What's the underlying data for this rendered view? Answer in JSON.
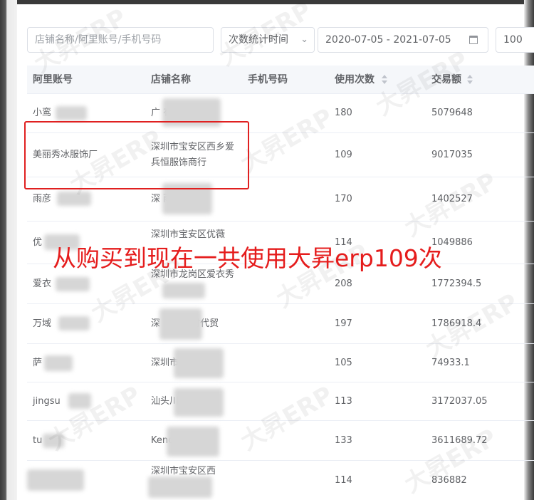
{
  "filters": {
    "search_placeholder": "店铺名称/阿里账号/手机号码",
    "time_select_value": "次数统计时间",
    "date_range": "2020-07-05 - 2021-07-05",
    "page_size": "100"
  },
  "table": {
    "headers": [
      "阿里账号",
      "店铺名称",
      "手机号码",
      "使用次数",
      "交易额"
    ],
    "rows": [
      {
        "account": "小鸾",
        "shop": "广 有限公司",
        "phone": "",
        "uses": "180",
        "amount": "5079648"
      },
      {
        "account": "美丽秀冰服饰厂",
        "shop": "深圳市宝安区西乡爱兵恒服饰商行",
        "phone": "",
        "uses": "109",
        "amount": "9017035"
      },
      {
        "account": "雨彦",
        "shop": "深 雨蒂旺",
        "phone": "",
        "uses": "170",
        "amount": "1402527"
      },
      {
        "account": "优",
        "shop": "深圳市宝安区优薇",
        "phone": "",
        "uses": "114",
        "amount": "1049886"
      },
      {
        "account": "爱衣",
        "shop": "深圳市龙岗区爱衣秀",
        "phone": "",
        "uses": "208",
        "amount": "1772394.5"
      },
      {
        "account": "万域",
        "shop": "深 区万域时代贸",
        "phone": "",
        "uses": "197",
        "amount": "1786918.4"
      },
      {
        "account": "萨",
        "shop": "深圳市 品有限",
        "phone": "",
        "uses": "105",
        "amount": "74933.1"
      },
      {
        "account": "jingsu",
        "shop": "汕头川 头",
        "phone": "",
        "uses": "113",
        "amount": "3172037.05"
      },
      {
        "account": "tu",
        "shop": "Kend 专营",
        "phone": "",
        "uses": "133",
        "amount": "3611689.72"
      },
      {
        "account": "",
        "shop": "深圳市宝安区西",
        "phone": "",
        "uses": "114",
        "amount": "836882"
      }
    ]
  },
  "watermark": "大昇ERP",
  "annotation": {
    "text": "从购买到现在一共使用大昇erp109次",
    "color": "#e51c1c"
  }
}
